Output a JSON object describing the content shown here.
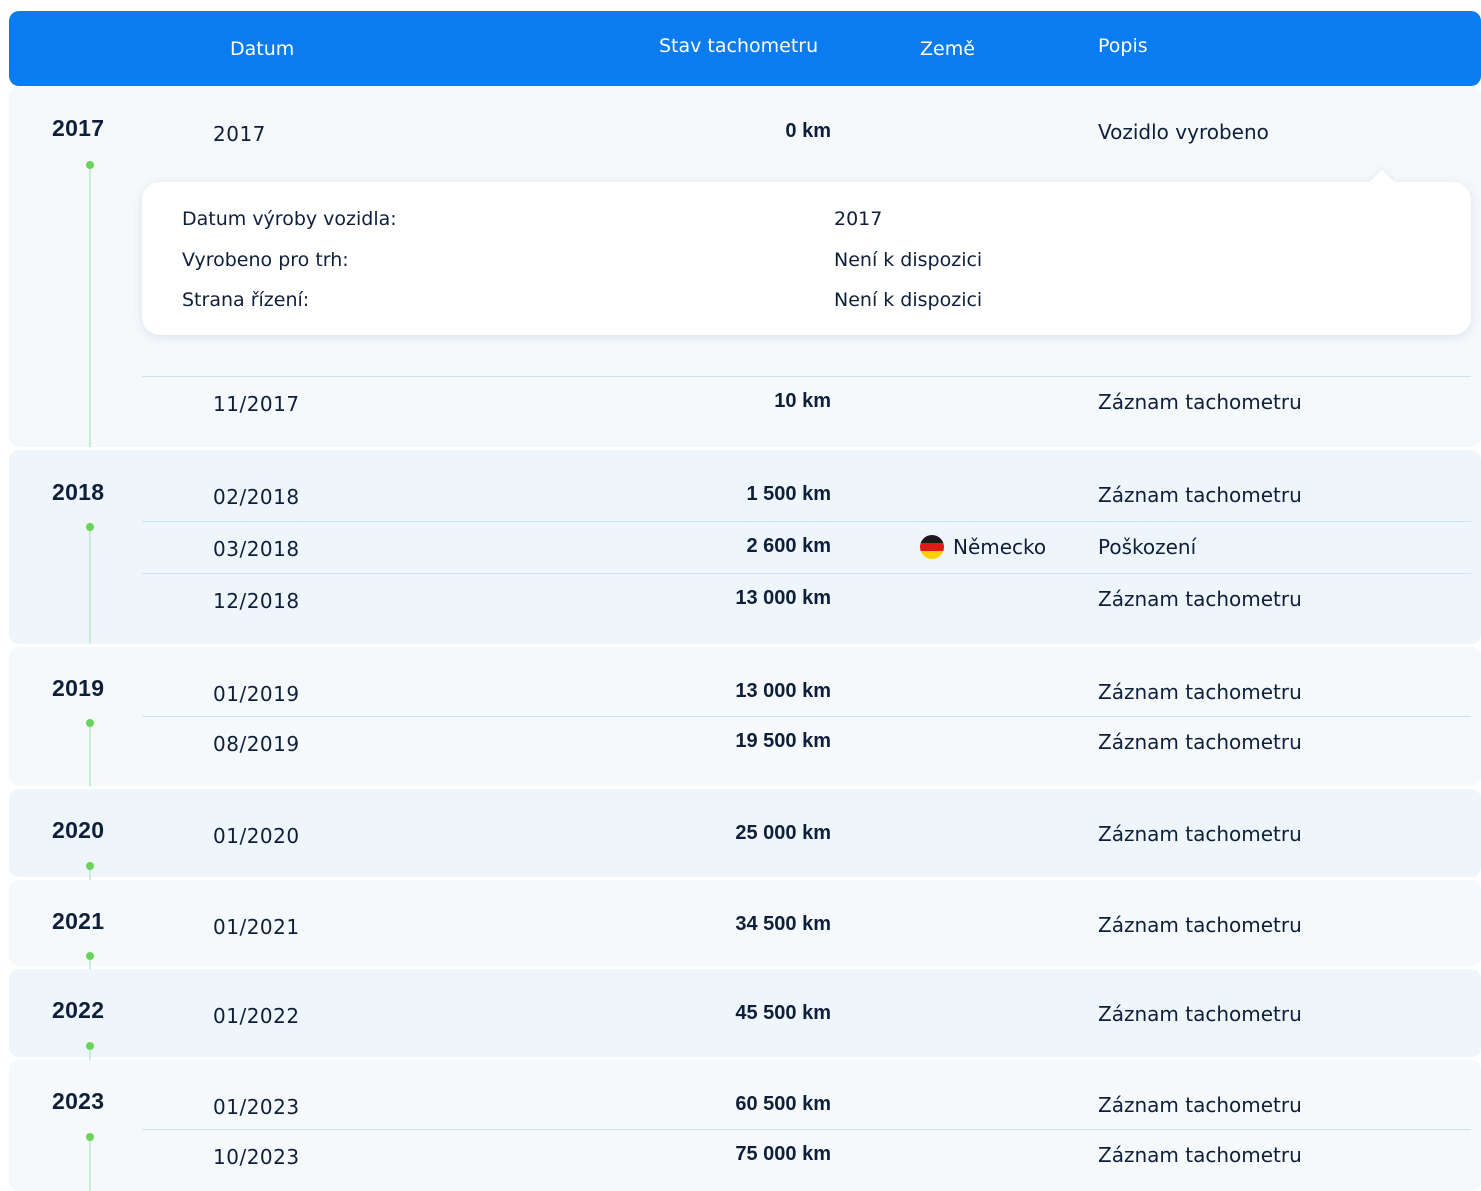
{
  "header": {
    "col_date": "Datum",
    "col_odometer": "Stav tachometru",
    "col_country": "Země",
    "col_description": "Popis",
    "bg_color": "#0a7cf0"
  },
  "popup": {
    "rows": [
      {
        "label": "Datum výroby vozidla:",
        "value": "2017"
      },
      {
        "label": "Vyrobeno pro trh:",
        "value": "Není k dispozici"
      },
      {
        "label": "Strana řízení:",
        "value": "Není k dispozici"
      }
    ]
  },
  "groups": [
    {
      "year": "2017",
      "entries": [
        {
          "date": "2017",
          "odometer": "0 km",
          "country": "",
          "description": "Vozidlo vyrobeno"
        },
        {
          "date": "11/2017",
          "odometer": "10 km",
          "country": "",
          "description": "Záznam tachometru"
        }
      ]
    },
    {
      "year": "2018",
      "entries": [
        {
          "date": "02/2018",
          "odometer": "1 500 km",
          "country": "",
          "description": "Záznam tachometru"
        },
        {
          "date": "03/2018",
          "odometer": "2 600 km",
          "country": "Německo",
          "country_flag": "germany-flag-icon",
          "description": "Poškození"
        },
        {
          "date": "12/2018",
          "odometer": "13 000 km",
          "country": "",
          "description": "Záznam tachometru"
        }
      ]
    },
    {
      "year": "2019",
      "entries": [
        {
          "date": "01/2019",
          "odometer": "13 000 km",
          "country": "",
          "description": "Záznam tachometru"
        },
        {
          "date": "08/2019",
          "odometer": "19 500 km",
          "country": "",
          "description": "Záznam tachometru"
        }
      ]
    },
    {
      "year": "2020",
      "entries": [
        {
          "date": "01/2020",
          "odometer": "25 000 km",
          "country": "",
          "description": "Záznam tachometru"
        }
      ]
    },
    {
      "year": "2021",
      "entries": [
        {
          "date": "01/2021",
          "odometer": "34 500 km",
          "country": "",
          "description": "Záznam tachometru"
        }
      ]
    },
    {
      "year": "2022",
      "entries": [
        {
          "date": "01/2022",
          "odometer": "45 500 km",
          "country": "",
          "description": "Záznam tachometru"
        }
      ]
    },
    {
      "year": "2023",
      "entries": [
        {
          "date": "01/2023",
          "odometer": "60 500 km",
          "country": "",
          "description": "Záznam tachometru"
        },
        {
          "date": "10/2023",
          "odometer": "75 000 km",
          "country": "",
          "description": "Záznam tachometru"
        }
      ]
    }
  ],
  "colors": {
    "timeline_dot": "#6ad35a",
    "row_alt": "#eef6fc",
    "row_std": "#f5f9fc"
  }
}
